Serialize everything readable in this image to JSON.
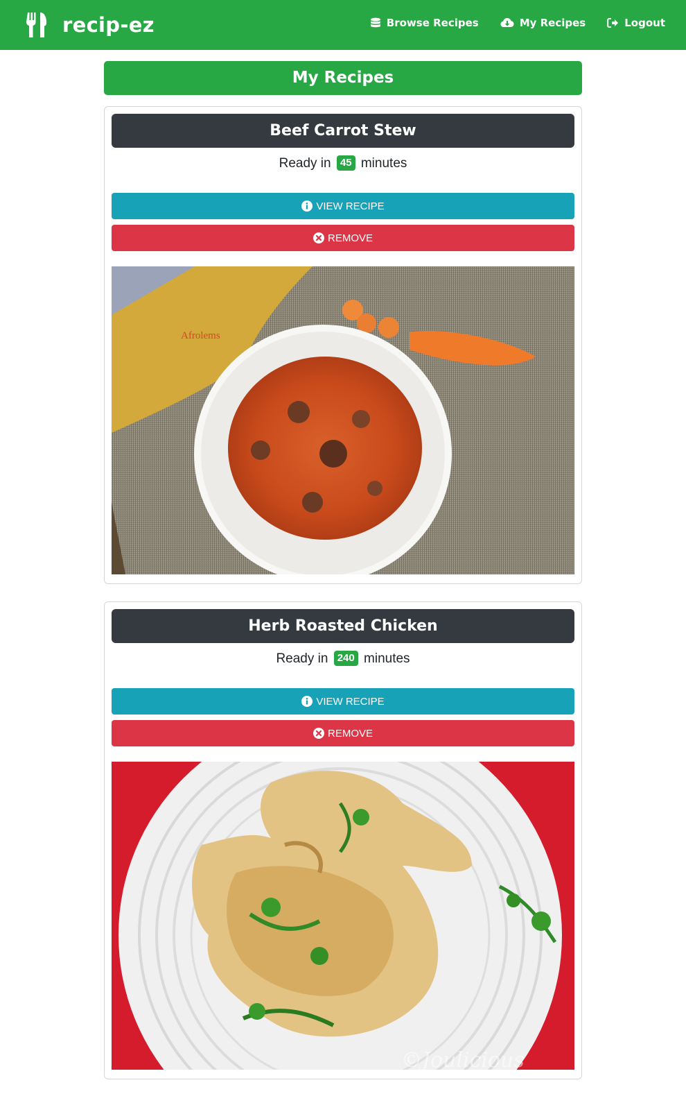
{
  "app": {
    "brand": "recip-ez"
  },
  "nav": {
    "browse_label": "Browse Recipes",
    "my_recipes_label": "My Recipes",
    "logout_label": "Logout"
  },
  "page": {
    "title": "My Recipes"
  },
  "recipes": [
    {
      "name": "Beef Carrot Stew",
      "ready_prefix": "Ready in",
      "minutes": "45",
      "ready_suffix": "minutes",
      "view_label": "VIEW RECIPE",
      "remove_label": "REMOVE",
      "photo_text": "Afrolems"
    },
    {
      "name": "Herb Roasted Chicken",
      "ready_prefix": "Ready in",
      "minutes": "240",
      "ready_suffix": "minutes",
      "view_label": "VIEW RECIPE",
      "remove_label": "REMOVE",
      "photo_text": "©Joulicious"
    }
  ],
  "colors": {
    "navbar": "#28a745",
    "card_header": "#343a40",
    "view_button": "#17a2b8",
    "remove_button": "#dc3545"
  },
  "icons": {
    "brand": "utensils-icon",
    "browse": "database-icon",
    "my_recipes": "cloud-download-icon",
    "logout": "sign-out-icon",
    "view": "info-circle-icon",
    "remove": "times-circle-icon"
  }
}
